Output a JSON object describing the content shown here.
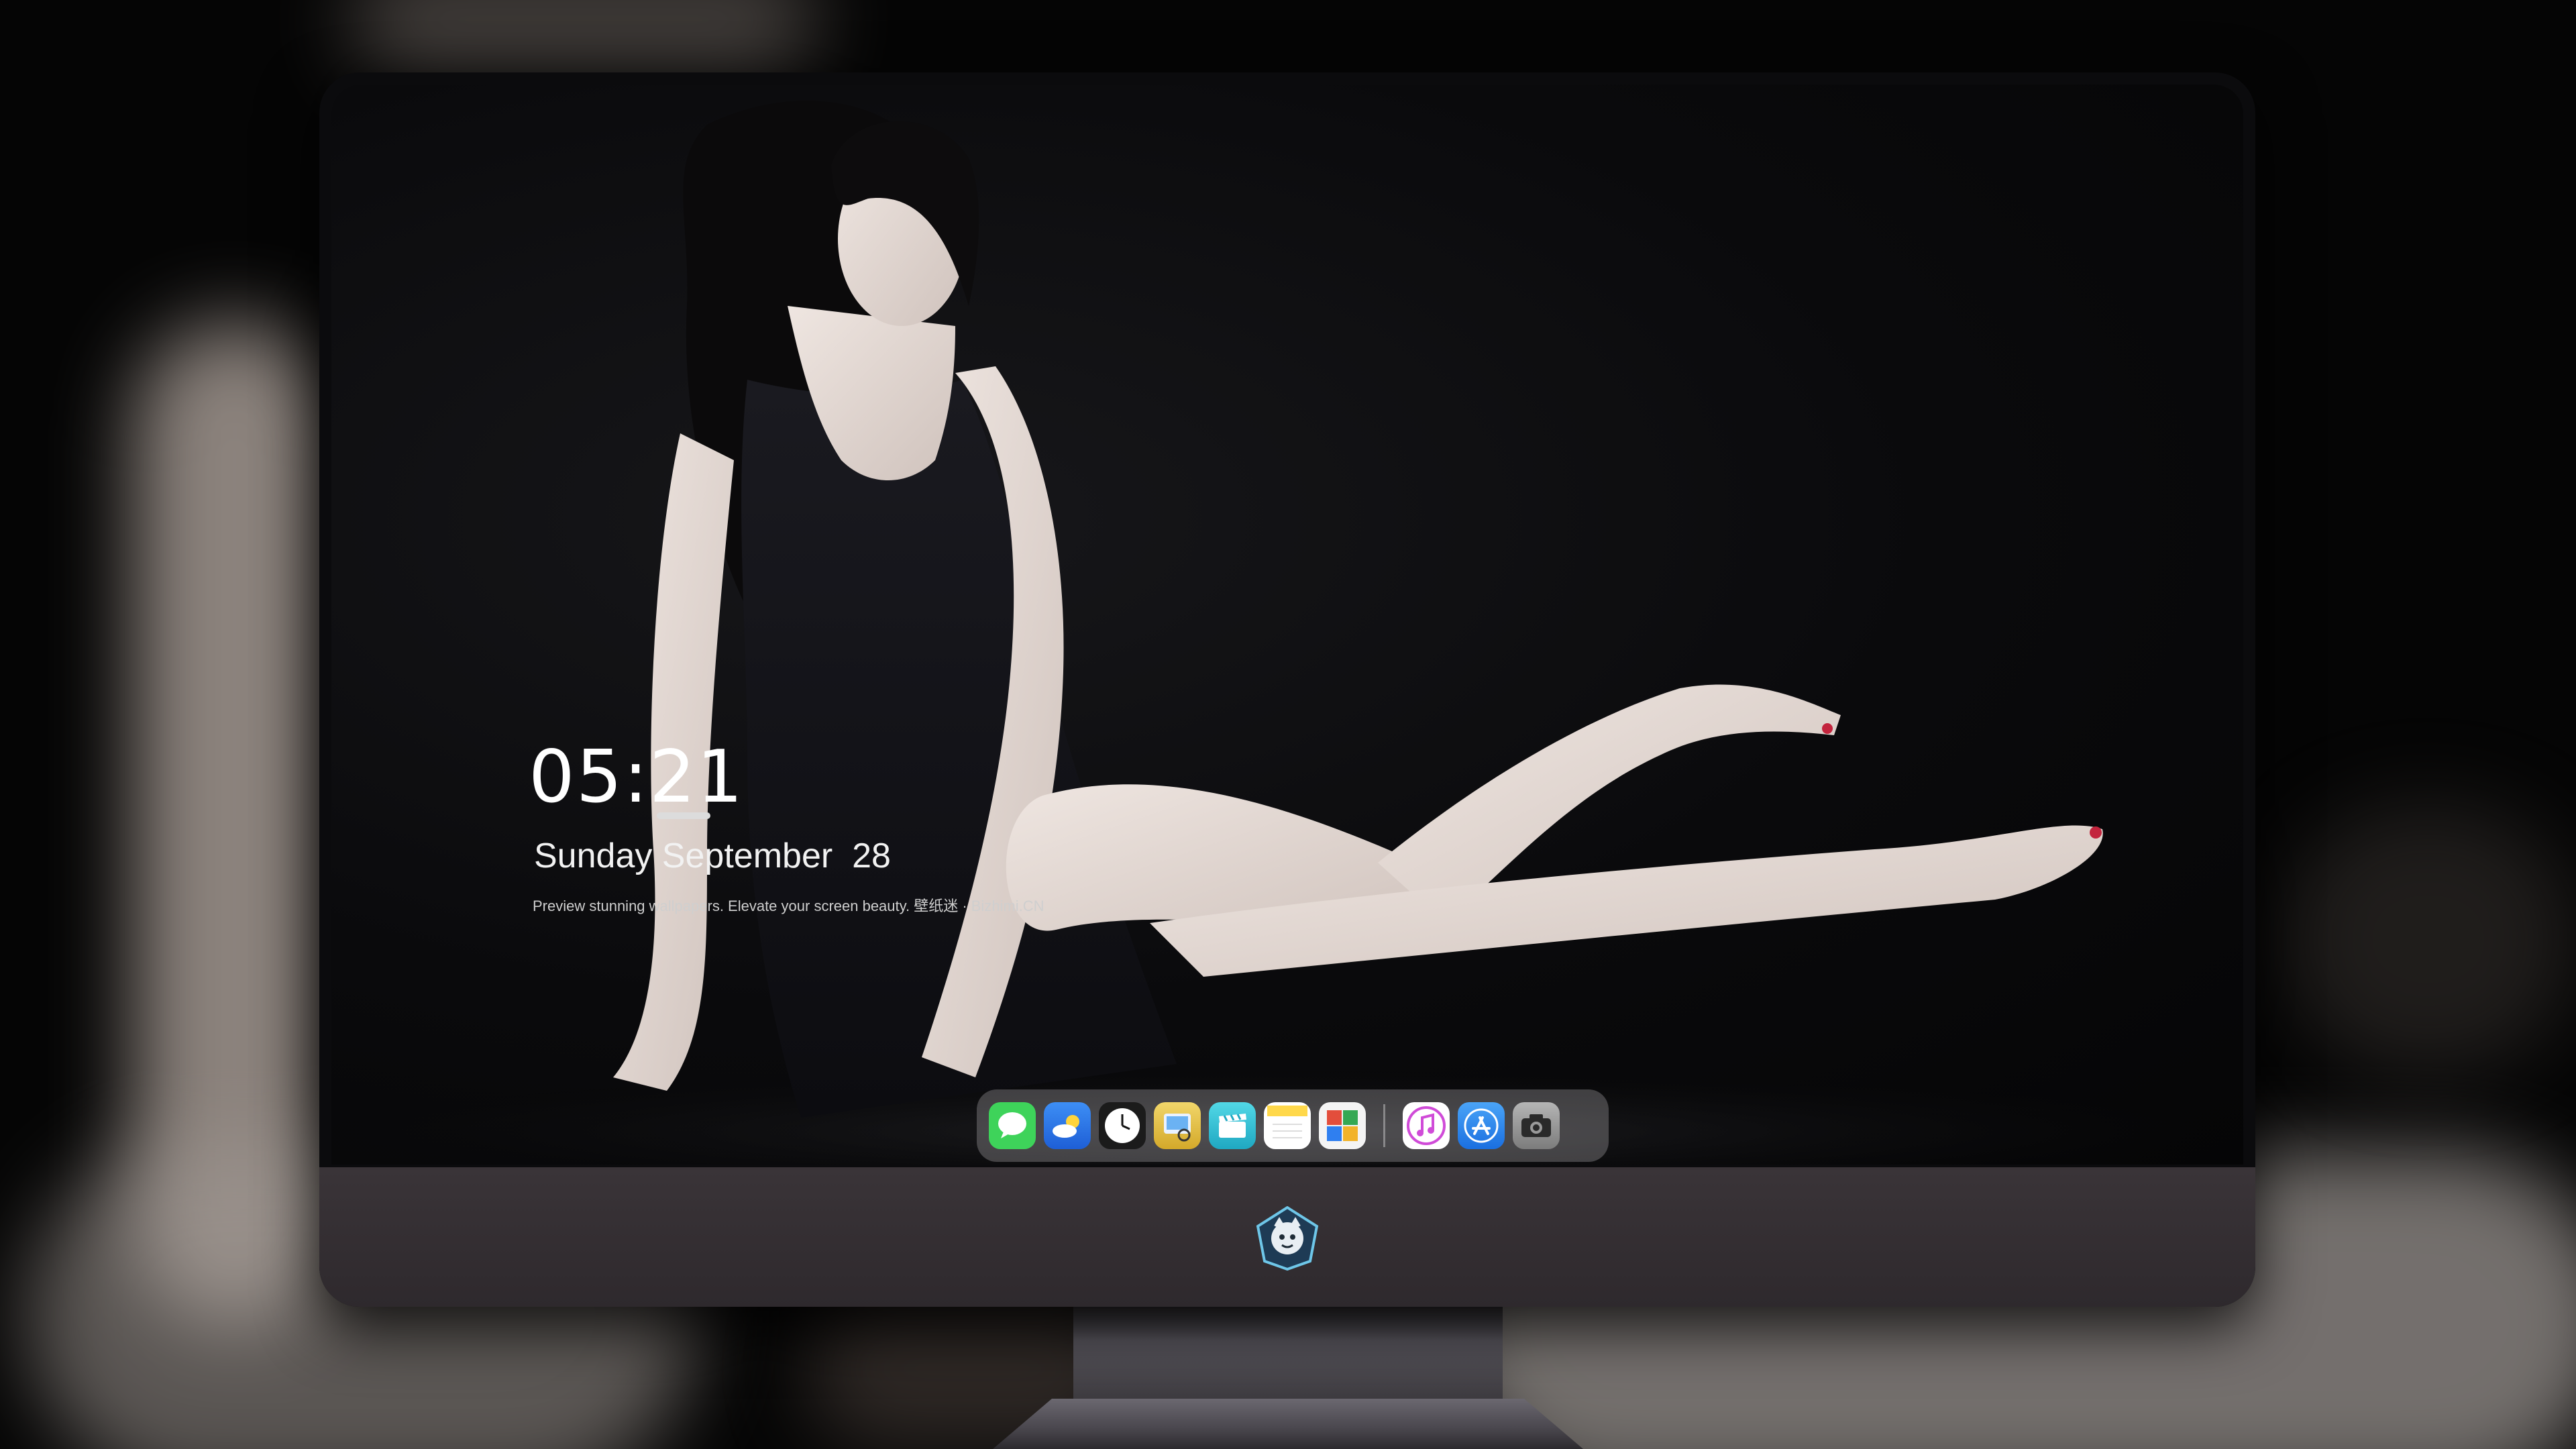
{
  "lock_screen": {
    "time": "05:21",
    "date": "Sunday September  28",
    "tagline": "Preview stunning wallpapers. Elevate your screen beauty. 壁纸迷 · Bizhimi.CN"
  },
  "dock": {
    "apps": [
      {
        "name": "Messages",
        "icon": "message-bubble-icon",
        "color": "#3ed35a"
      },
      {
        "name": "Weather",
        "icon": "cloud-sun-icon",
        "color": "#2f7ff0"
      },
      {
        "name": "Clock",
        "icon": "clock-icon",
        "color": "#f4f4f4"
      },
      {
        "name": "Preview",
        "icon": "preview-icon",
        "color": "#e7c84e"
      },
      {
        "name": "Clips",
        "icon": "clapperboard-icon",
        "color": "#38c9d9"
      },
      {
        "name": "Notes",
        "icon": "notes-icon",
        "color": "#ffd84a"
      },
      {
        "name": "Photo Booth",
        "icon": "photo-grid-icon",
        "color": "#e34e3c"
      },
      {
        "name": "Music",
        "icon": "music-note-icon",
        "color": "#d04bd8"
      },
      {
        "name": "App Store",
        "icon": "app-store-icon",
        "color": "#2e8cf0"
      },
      {
        "name": "Camera",
        "icon": "camera-icon",
        "color": "#9a9a9a"
      }
    ]
  },
  "monitor": {
    "logo": "mascot-badge-icon"
  }
}
